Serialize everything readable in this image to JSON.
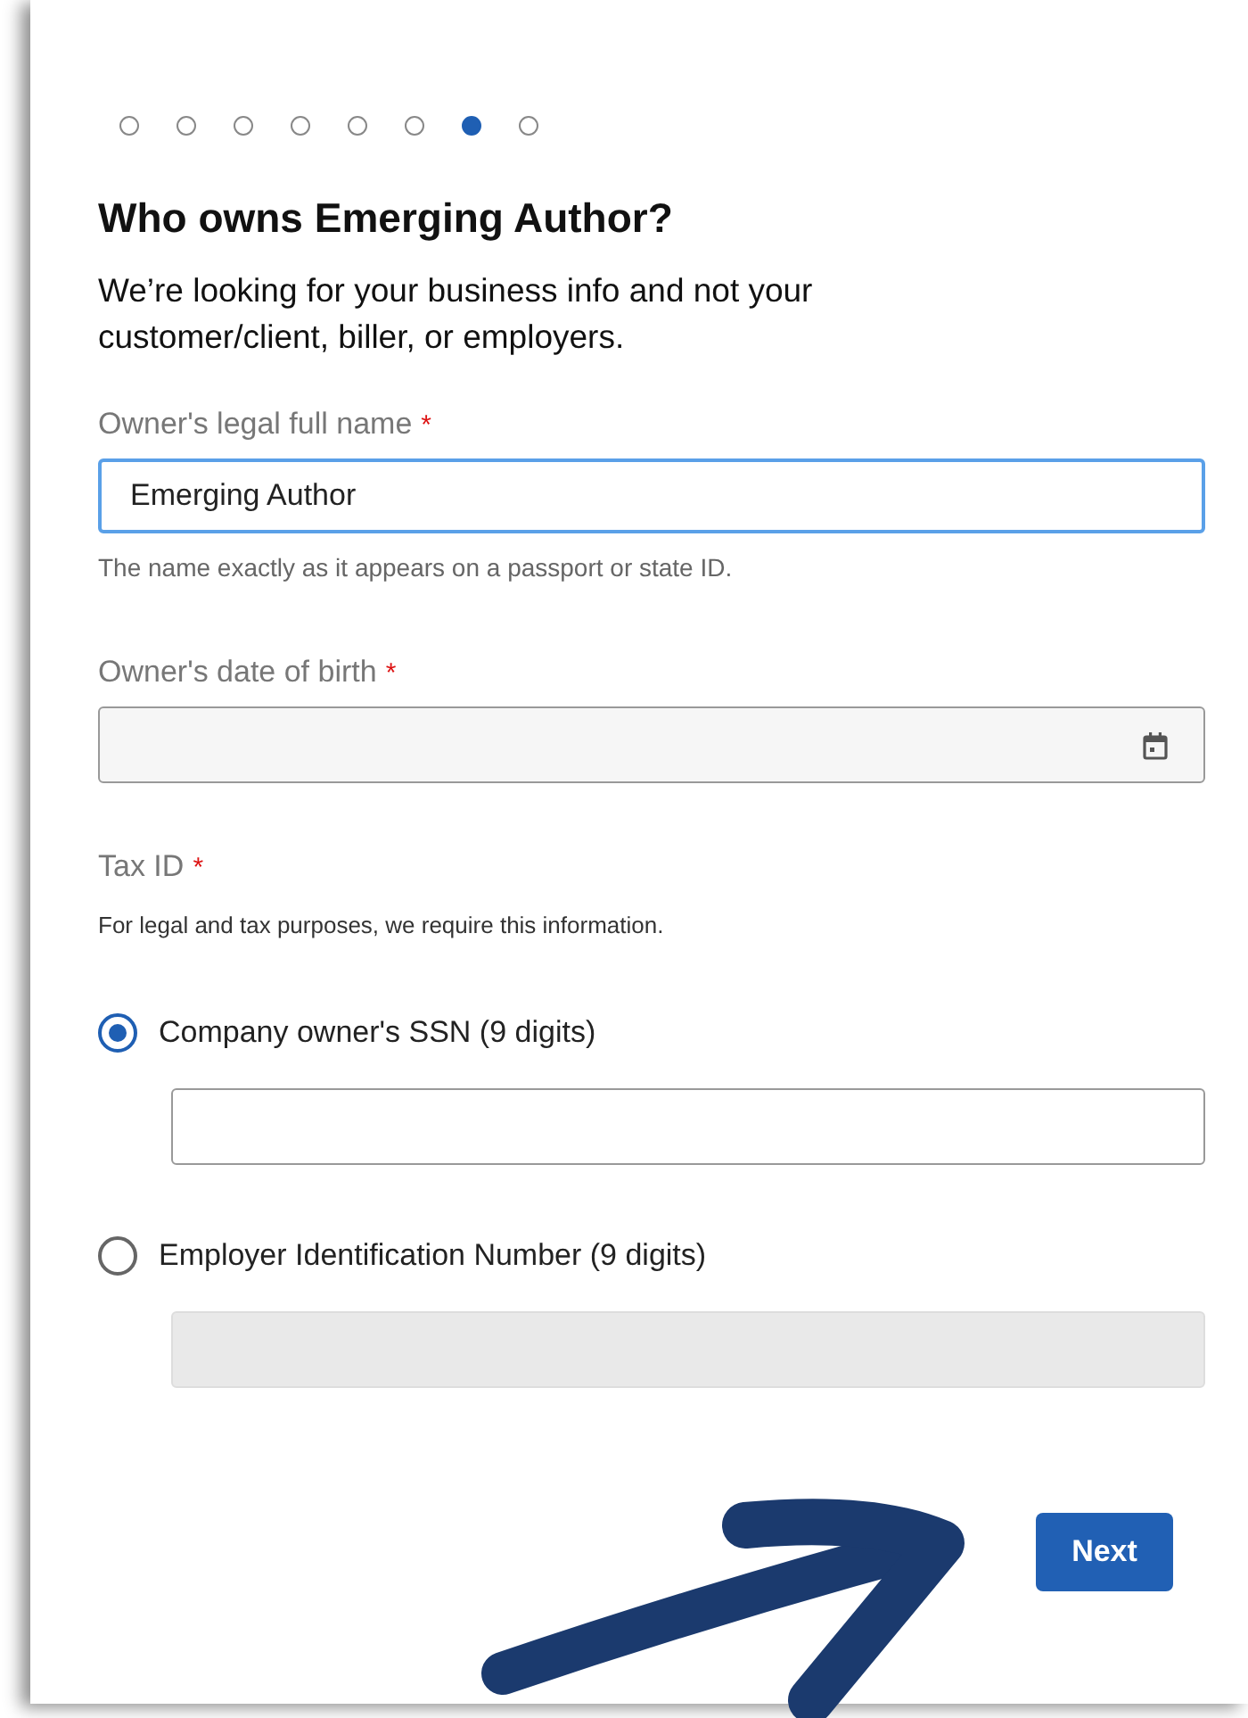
{
  "steps": [
    {
      "selected": false
    },
    {
      "selected": false
    },
    {
      "selected": false
    },
    {
      "selected": false
    },
    {
      "selected": false
    },
    {
      "selected": false
    },
    {
      "selected": true
    },
    {
      "selected": false
    }
  ],
  "title": "Who owns Emerging Author?",
  "subtitle": "We’re looking for your business info and not your customer/client, biller, or employers.",
  "name_field": {
    "label": "Owner's legal full name",
    "required_mark": "*",
    "value": "Emerging Author",
    "focused": true,
    "help": "The name exactly as it appears on a passport or state ID."
  },
  "birth_field": {
    "label": "Owner's date of birth",
    "required_mark": "*"
  },
  "tax_id": {
    "label": "Tax ID",
    "required_mark": "*",
    "note": "For legal and tax purposes, we require this information.",
    "options": [
      {
        "label": "Company owner's SSN (9 digits)",
        "selected": true,
        "disabled": false
      },
      {
        "label": "Employer Identification Number (9 digits)",
        "selected": false,
        "disabled": true
      }
    ]
  },
  "next_button": "Next"
}
